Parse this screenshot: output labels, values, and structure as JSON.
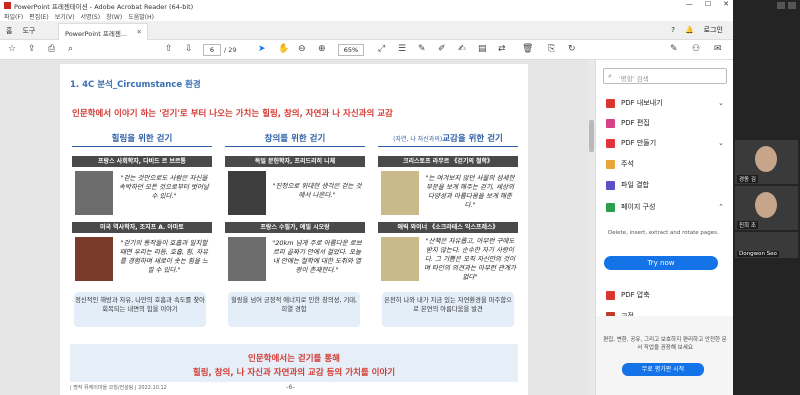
{
  "window": {
    "title": "PowerPoint 프레젠테이션 - Adobe Acrobat Reader (64-bit)",
    "controls": [
      "—",
      "☐",
      "✕"
    ]
  },
  "menu": [
    "파일(F)",
    "편집(E)",
    "보기(V)",
    "서명(S)",
    "창(W)",
    "도움말(H)"
  ],
  "tabbar": {
    "home": "홈",
    "tools": "도구",
    "doc_tab": "PowerPoint 프레젠...",
    "doc_close": "✕",
    "help": "?",
    "bell": "🔔",
    "login": "로그인"
  },
  "toolbar": {
    "page_current": "6",
    "page_total": "/ 29",
    "zoom": "65%"
  },
  "slide": {
    "heading": "1. 4C 분석_Circumstance 환경",
    "subtitle": "인문학에서 이야기 하는 '걷기'로 부터 나오는 가치는 힐링, 창의, 자연과 나 자신과의 교감",
    "columns": [
      {
        "title": "힐링을 위한 걷기",
        "title_small": "",
        "person1": {
          "header": "프랑스 사회학자, 다비드 르 브르통",
          "quote": "\"걷는 것만으로도 사람은 자신을 속박하던 모든 것으로부터 벗어날 수 있다.\""
        },
        "person2": {
          "header": "미국 역사학자, 조지프 A. 아마토",
          "quote": "\"걷기의 동작들이 호흡과 일치할 때면 우리는 리듬, 호흡, 힘, 자유를 경험하며 새로이 솟는 힘을 느낄 수 있다.\""
        },
        "summary": "정신적인 해방과 자유, 나만의 호흡과 속도를 찾아 회복되는 내면의 힘을 이야기"
      },
      {
        "title": "창의를 위한 걷기",
        "title_small": "",
        "person1": {
          "header": "독일 문헌학자, 프리드리히 니체",
          "quote": "\"진정으로 위대한 생각은 걷는 것에서 나온다.\""
        },
        "person2": {
          "header": "프랑스 수필가, 에밀 시오랑",
          "quote": "\"20km 넘게 주로 아름다운 로브르리 골짜기 안에서 걸었다. 오늘 내 안에는 철학에 대한 도취와 열광이 존재한다.\""
        },
        "summary": "힐링을 넘어 긍정적 에너지로 인한 창의성, 기대, 희열 경험"
      },
      {
        "title": "교감을 위한 걷기",
        "title_small": "(자연, 나 자신과의)",
        "person1": {
          "header": "크리스토프 라무르 《걷기의 철학》",
          "quote": "\"는 여겨보지 않던 사물의 섬세한 부분을 보게 해주는 걷기, 세상의 다양성과 아름다움을 보게 해준다.\""
        },
        "person2": {
          "header": "애릭 와이너 《소크라테스 익스프레스》",
          "quote": "\"산책은 자유롭고, 아무런 구애도 받지 않는다. 순수한 자기 사랑이다. 그 기쁨은 오직 자신만의 것이며 타인의 의견과는 아무런 관계가 없다\""
        },
        "summary": "온전히 나와 내가 지금 있는 자연환경을 마주함으로 본연의 아름다움을 발견"
      }
    ],
    "banner_line1": "인문학에서는 걷기를 통해",
    "banner_line2": "힐링, 창의, 나 자신과 자연과의 교감 등의 가치를 이야기",
    "footer_left": "| 명작 뮤케이마을 코칭/컨설팅 | 2022.10.12",
    "footer_page": "-6-"
  },
  "sidebar": {
    "search_placeholder": "'명할' 검색",
    "items": [
      {
        "label": "PDF 내보내기",
        "color": "#d9372d",
        "chevron": "⌄"
      },
      {
        "label": "PDF 편집",
        "color": "#d64089",
        "chevron": ""
      },
      {
        "label": "PDF 만들기",
        "color": "#e2343a",
        "chevron": "⌄"
      },
      {
        "label": "주석",
        "color": "#e8a53a",
        "chevron": ""
      },
      {
        "label": "파일 결합",
        "color": "#5d51c9",
        "chevron": ""
      },
      {
        "label": "페이지 구성",
        "color": "#2e9e4f",
        "chevron": "⌃"
      }
    ],
    "organize_desc": "Delete, insert, extract and rotate pages.",
    "try_now": "Try now",
    "more_items": [
      {
        "label": "PDF 압축",
        "color": "#d9372d"
      },
      {
        "label": "교정",
        "color": "#c0392b"
      }
    ],
    "promo_text": "편집, 변환, 공유, 그리고 보호하지 편리하고 안전한 문서 작업을 권장해 보세요",
    "promo_button": "무료 평가판 시작"
  },
  "video": {
    "participants": [
      {
        "name": "경동 김"
      },
      {
        "name": "진희 조"
      },
      {
        "name": "Dongwon Seo"
      }
    ]
  }
}
